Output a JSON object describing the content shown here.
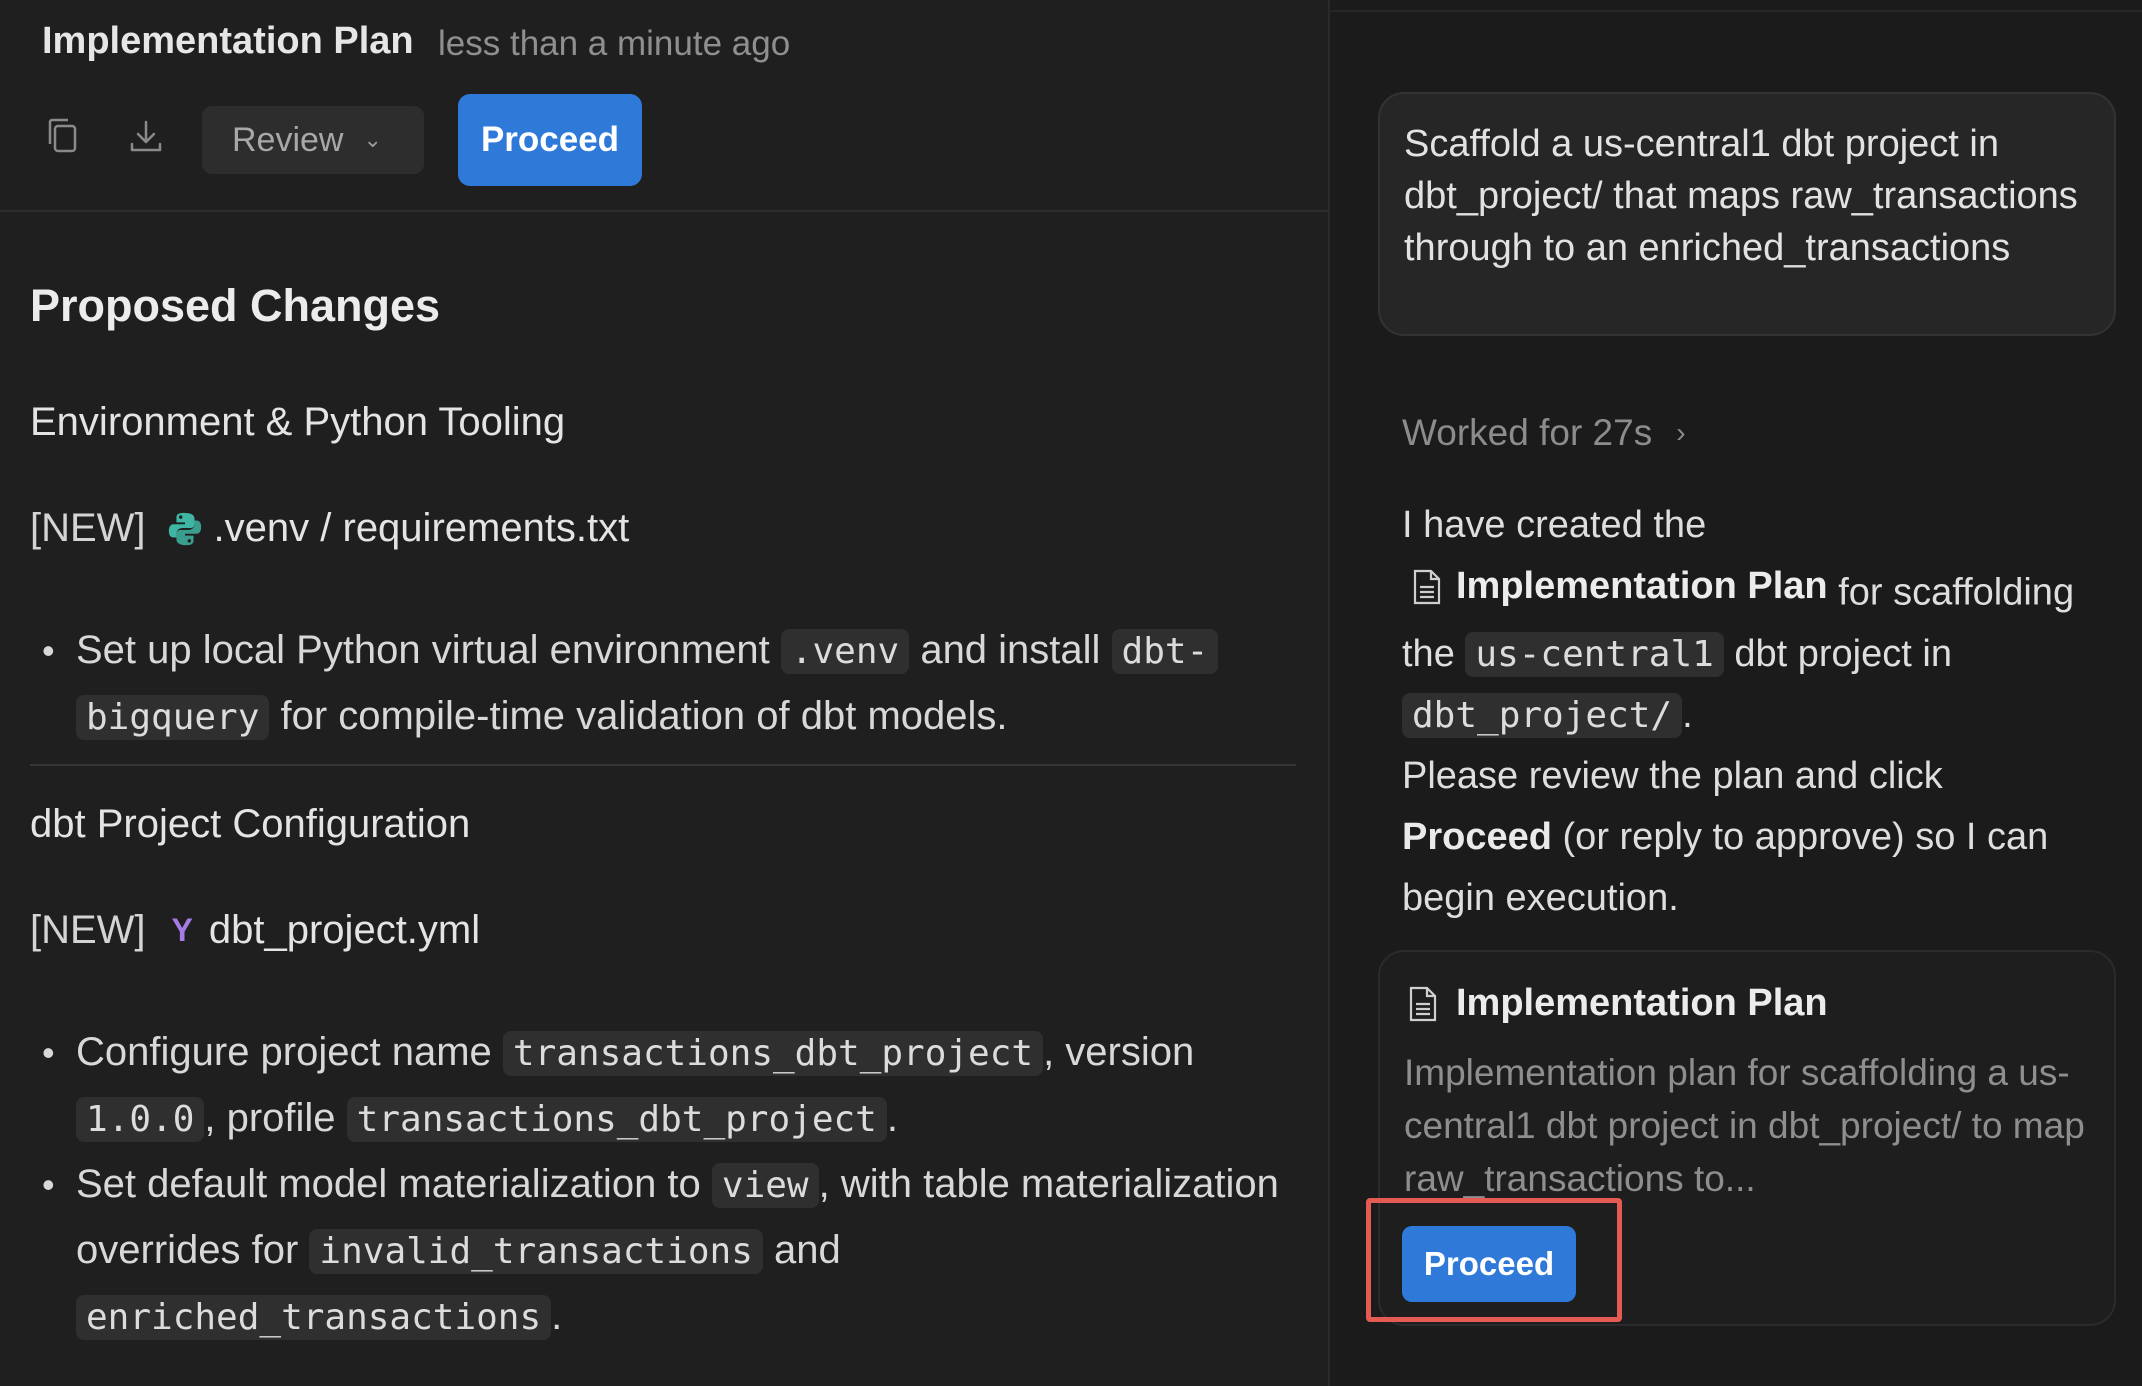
{
  "header": {
    "title": "Implementation Plan",
    "timestamp": "less than a minute ago",
    "review_label": "Review",
    "proceed_label": "Proceed"
  },
  "doc": {
    "heading": "Proposed Changes",
    "sections": [
      {
        "title": "Environment & Python Tooling",
        "file_tag": "[NEW]",
        "file_name": ".venv / requirements.txt",
        "file_icon": "python-icon",
        "bullets": [
          {
            "parts": [
              {
                "t": "Set up local Python virtual environment "
              },
              {
                "c": ".venv"
              },
              {
                "t": " and install "
              },
              {
                "c": "dbt-"
              },
              {
                "c": "bigquery"
              },
              {
                "t": " for compile-time validation of dbt models."
              }
            ]
          }
        ]
      },
      {
        "title": "dbt Project Configuration",
        "file_tag": "[NEW]",
        "file_name": "dbt_project.yml",
        "file_icon": "yaml-icon",
        "bullets": [
          {
            "parts": [
              {
                "t": "Configure project name "
              },
              {
                "c": "transactions_dbt_project"
              },
              {
                "t": ", version "
              },
              {
                "c": "1.0.0"
              },
              {
                "t": ", profile "
              },
              {
                "c": "transactions_dbt_project"
              },
              {
                "t": "."
              }
            ]
          },
          {
            "parts": [
              {
                "t": "Set default model materialization to "
              },
              {
                "c": "view"
              },
              {
                "t": ", with table materialization overrides for "
              },
              {
                "c": "invalid_transactions"
              },
              {
                "t": " and "
              },
              {
                "c": "enriched_transactions"
              },
              {
                "t": "."
              }
            ]
          }
        ]
      }
    ]
  },
  "chat": {
    "prompt": "Scaffold a us-central1 dbt project in dbt_project/ that maps raw_transactions through to an enriched_transactions",
    "worked_label": "Worked for 27s",
    "reply": {
      "intro": "I have created the",
      "plan_link": "Implementation Plan",
      "after_link": "for scaffolding the",
      "code1": "us-central1",
      "mid": "dbt project in",
      "code2": "dbt_project/",
      "end": ".",
      "line2": "Please review the plan and click",
      "bold": "Proceed",
      "tail": "(or reply to approve) so I can begin execution."
    },
    "artifact": {
      "title": "Implementation Plan",
      "description": "Implementation plan for scaffolding a us-central1 dbt project in dbt_project/ to map raw_transactions to...",
      "proceed_label": "Proceed"
    }
  },
  "colors": {
    "accent": "#2f7ad9",
    "highlight": "#e45b53",
    "python": "#3fb5a3",
    "yaml": "#a57be6"
  }
}
